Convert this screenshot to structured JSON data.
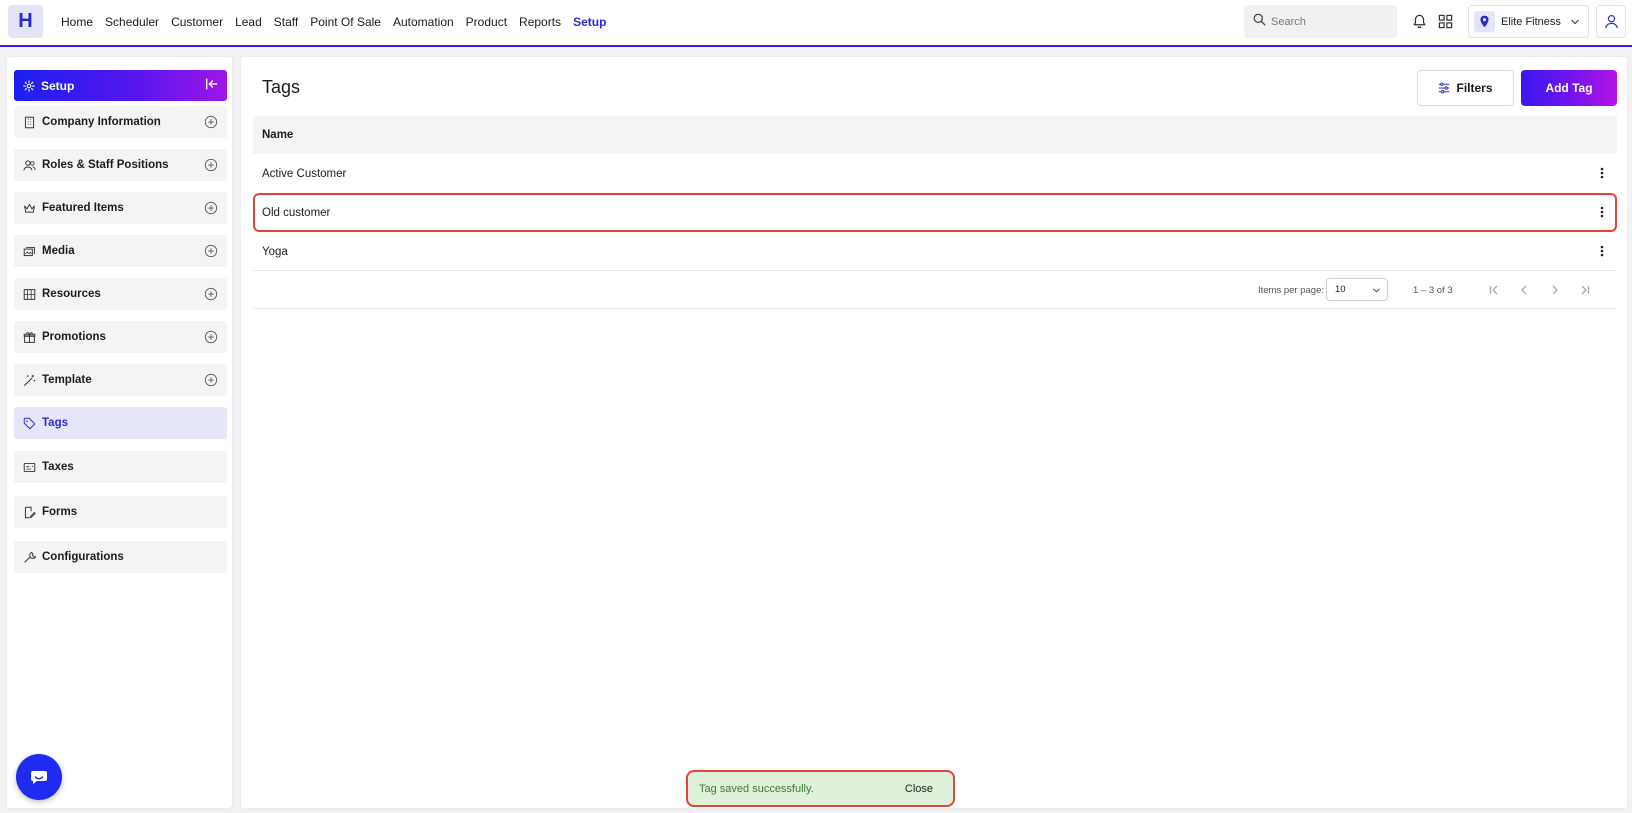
{
  "app": {
    "logo_letter": "H"
  },
  "nav": {
    "items": [
      "Home",
      "Scheduler",
      "Customer",
      "Lead",
      "Staff",
      "Point Of Sale",
      "Automation",
      "Product",
      "Reports",
      "Setup"
    ],
    "active": "Setup"
  },
  "search": {
    "placeholder": "Search"
  },
  "location": {
    "selected": "Elite Fitness"
  },
  "sidebar": {
    "header": "Setup",
    "items": [
      {
        "label": "Company Information",
        "icon": "building-icon",
        "expandable": true
      },
      {
        "label": "Roles & Staff Positions",
        "icon": "users-icon",
        "expandable": true
      },
      {
        "label": "Featured Items",
        "icon": "crown-icon",
        "expandable": true
      },
      {
        "label": "Media",
        "icon": "media-icon",
        "expandable": true
      },
      {
        "label": "Resources",
        "icon": "resources-icon",
        "expandable": true
      },
      {
        "label": "Promotions",
        "icon": "gift-icon",
        "expandable": true
      },
      {
        "label": "Template",
        "icon": "magic-wand-icon",
        "expandable": true
      },
      {
        "label": "Tags",
        "icon": "tag-icon",
        "expandable": false,
        "active": true
      },
      {
        "label": "Taxes",
        "icon": "tax-card-icon",
        "expandable": false
      },
      {
        "label": "Forms",
        "icon": "form-edit-icon",
        "expandable": false
      },
      {
        "label": "Configurations",
        "icon": "wrench-icon",
        "expandable": false
      }
    ]
  },
  "main": {
    "title": "Tags",
    "filters_label": "Filters",
    "add_label": "Add Tag",
    "table": {
      "header": "Name",
      "rows": [
        "Active Customer",
        "Old customer",
        "Yoga"
      ],
      "highlighted_row": "Old customer"
    },
    "paginator": {
      "items_per_page_label": "Items per page:",
      "items_per_page": "10",
      "range": "1 – 3 of 3"
    }
  },
  "toast": {
    "message": "Tag saved successfully.",
    "close_label": "Close"
  },
  "colors": {
    "accent": "#2b2bd6",
    "gradient_start": "#1b1ff0",
    "gradient_end": "#b514e6",
    "highlight": "#e0473a",
    "toast_bg": "#dff1d8"
  }
}
